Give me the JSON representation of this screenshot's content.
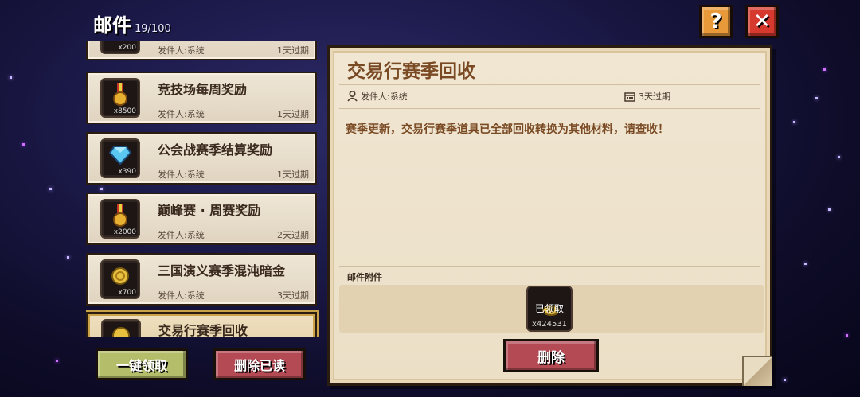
{
  "header": {
    "title": "邮件",
    "count": "19/100"
  },
  "buttons": {
    "help": "?",
    "close": "✕",
    "claim_all": "一键领取",
    "delete_read": "删除已读",
    "delete": "删除"
  },
  "mails": [
    {
      "title": "",
      "sender": "发件人:系统",
      "expire": "1天过期",
      "qty": "x200",
      "icon": "gem-purple-icon"
    },
    {
      "title": "竞技场每周奖励",
      "sender": "发件人:系统",
      "expire": "1天过期",
      "qty": "x8500",
      "icon": "medal-icon"
    },
    {
      "title": "公会战赛季结算奖励",
      "sender": "发件人:系统",
      "expire": "1天过期",
      "qty": "x390",
      "icon": "diamond-icon"
    },
    {
      "title": "巅峰赛 · 周赛奖励",
      "sender": "发件人:系统",
      "expire": "2天过期",
      "qty": "x2000",
      "icon": "medal-icon"
    },
    {
      "title": "三国演义赛季混沌暗金",
      "sender": "发件人:系统",
      "expire": "3天过期",
      "qty": "x700",
      "icon": "coin-icon"
    },
    {
      "title": "交易行赛季回收",
      "sender": "",
      "expire": "",
      "qty": "",
      "icon": "coin-icon"
    }
  ],
  "detail": {
    "title": "交易行赛季回收",
    "sender": "发件人:系统",
    "expire": "3天过期",
    "content": "赛季更新，交易行赛季道具已全部回收转换为其他材料，请查收！",
    "attachments_label": "邮件附件",
    "attachment": {
      "status": "已领取",
      "qty": "x424531",
      "icon": "coin-icon"
    }
  },
  "colors": {
    "title_brown": "#7a4a24",
    "green_button": "#b4be6a",
    "red_button": "#b44a54",
    "help_orange": "#e89a3a",
    "close_red": "#d63a2e"
  }
}
